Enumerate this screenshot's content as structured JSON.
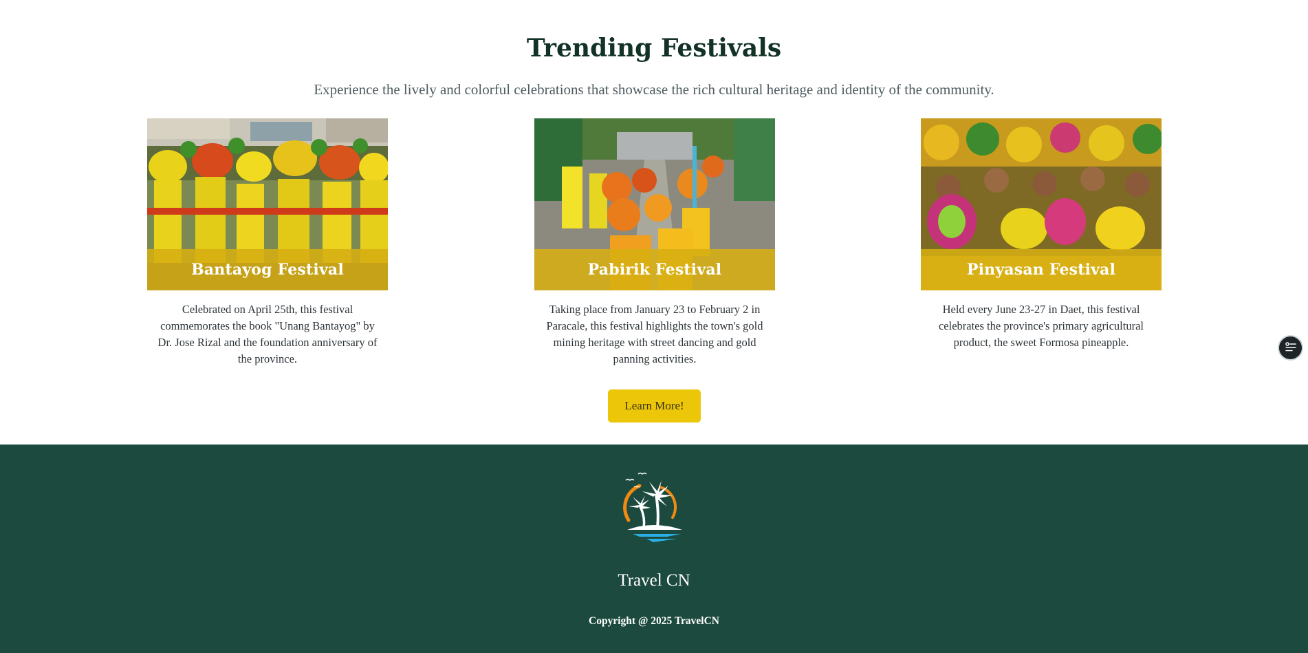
{
  "trending": {
    "title": "Trending Festivals",
    "subtitle": "Experience the lively and colorful celebrations that showcase the rich cultural heritage and identity of the community.",
    "overlay_color": "#d6ae12",
    "festivals": [
      {
        "name": "Bantayog Festival",
        "description": "Celebrated on April 25th, this festival commemorates the book \"Unang Bantayog\" by Dr. Jose Rizal and the foundation anniversary of the province.",
        "image_icon": "dancers-photo"
      },
      {
        "name": "Pabirik Festival",
        "description": "Taking place from January 23 to February 2 in Paracale, this festival highlights the town's gold mining heritage with street dancing and gold panning activities.",
        "image_icon": "parade-photo"
      },
      {
        "name": "Pinyasan Festival",
        "description": "Held every June 23-27 in Daet, this festival celebrates the province's primary agricultural product, the sweet Formosa pineapple.",
        "image_icon": "costumed-performers-photo"
      }
    ],
    "cta_label": "Learn More!",
    "cta_color": "#ecc608"
  },
  "footer": {
    "background": "#1c4a3e",
    "logo_icon": "palm-island-logo",
    "brand": "Travel CN",
    "copyright": "Copyright @ 2025 TravelCN"
  },
  "floating_button": {
    "icon": "list-settings-icon"
  }
}
